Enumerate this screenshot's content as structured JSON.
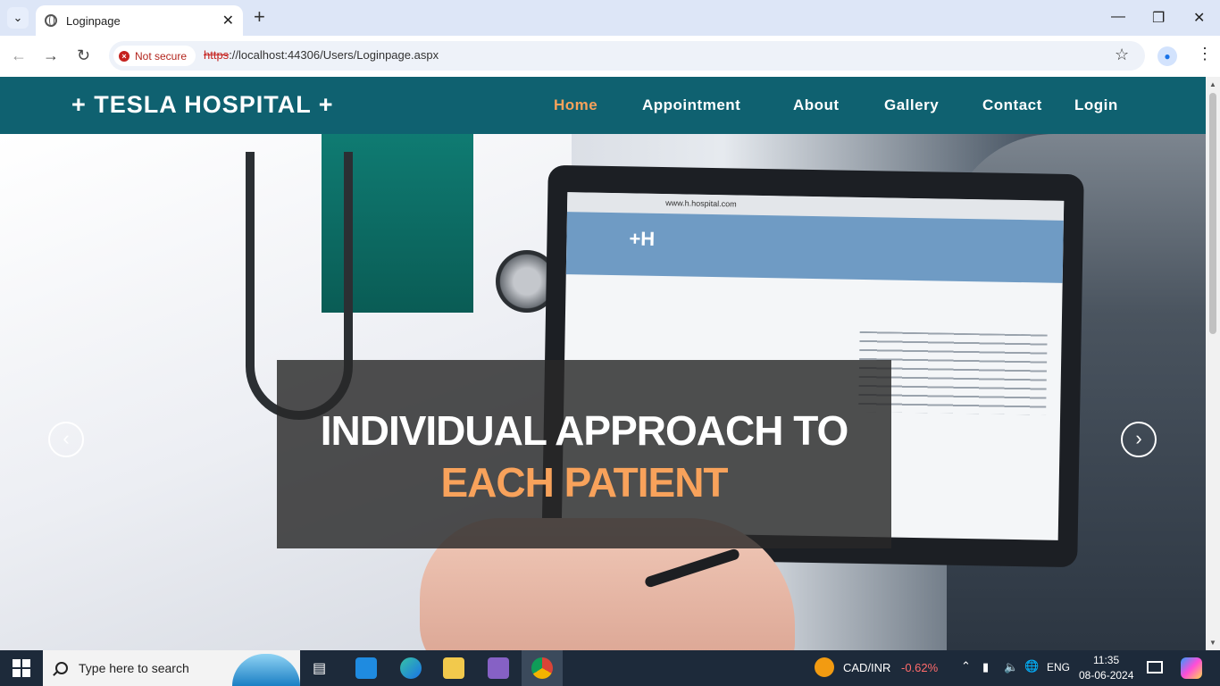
{
  "browser": {
    "tab_title": "Loginpage",
    "url_protocol": "https",
    "url_rest": "://localhost:44306/Users/Loginpage.aspx",
    "security_label": "Not secure"
  },
  "site": {
    "brand": "+ TESLA HOSPITAL +",
    "nav": [
      {
        "label": "Home"
      },
      {
        "label": "Appointment"
      },
      {
        "label": "About"
      },
      {
        "label": "Gallery"
      },
      {
        "label": "Contact"
      },
      {
        "label": "Login"
      }
    ],
    "hero": {
      "line1": "INDIVIDUAL APPROACH TO",
      "line2": "EACH PATIENT",
      "screen_url": "www.h.hospital.com",
      "screen_logo": "+H"
    }
  },
  "taskbar": {
    "search_placeholder": "Type here to search",
    "ticker_symbol": "CAD/INR",
    "ticker_change": "-0.62%",
    "language": "ENG",
    "time": "11:35",
    "date": "08-06-2024"
  },
  "colors": {
    "nav_bg": "#0f6170",
    "accent": "#f8a25b",
    "ticker_negative": "#ff6b6b"
  }
}
